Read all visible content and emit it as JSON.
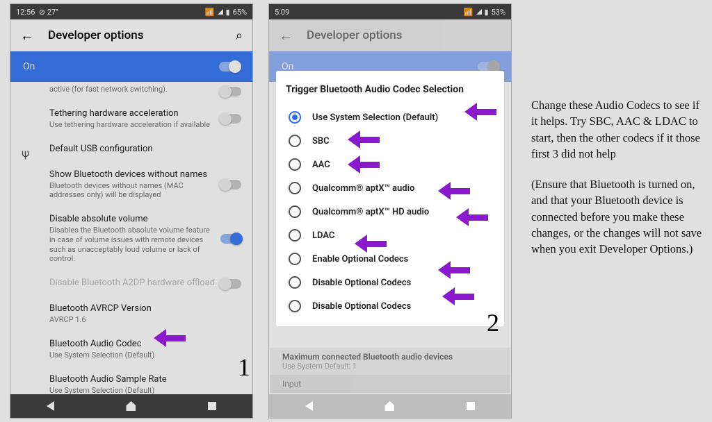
{
  "phone1": {
    "status": {
      "time": "12:56",
      "temp": "27°",
      "battery": "65%"
    },
    "appbar": {
      "title": "Developer options"
    },
    "onbar": "On",
    "rows": {
      "r0_sub": "active (for fast network switching).",
      "r1_title": "Tethering hardware acceleration",
      "r1_sub": "Use tethering hardware acceleration if available",
      "r2_title": "Default USB configuration",
      "r3_title": "Show Bluetooth devices without names",
      "r3_sub": "Bluetooth devices without names (MAC addresses only) will be displayed",
      "r4_title": "Disable absolute volume",
      "r4_sub": "Disables the Bluetooth absolute volume feature in case of volume issues with remote devices such as unacceptably loud volume or lack of control.",
      "r5_title": "Disable Bluetooth A2DP hardware offload",
      "r6_title": "Bluetooth AVRCP Version",
      "r6_sub": "AVRCP 1.6",
      "r7_title": "Bluetooth Audio Codec",
      "r7_sub": "Use System Selection (Default)",
      "r8_title": "Bluetooth Audio Sample Rate",
      "r8_sub": "Use System Selection (Default)"
    },
    "number": "1"
  },
  "phone2": {
    "status": {
      "time": "5:09",
      "battery": "53%"
    },
    "appbar": {
      "title": "Developer options"
    },
    "onbar": "On",
    "dialog": {
      "title": "Trigger Bluetooth Audio Codec Selection",
      "options": [
        "Use System Selection (Default)",
        "SBC",
        "AAC",
        "Qualcomm® aptX™ audio",
        "Qualcomm® aptX™ HD audio",
        "LDAC",
        "Enable Optional Codecs",
        "Disable Optional Codecs",
        "Disable Optional Codecs"
      ]
    },
    "dim1_t": "Maximum connected Bluetooth audio devices",
    "dim1_s": "Use System Default: 1",
    "dim2": "Input",
    "number": "2"
  },
  "instructions": {
    "p1": "Change these Audio Codecs to see if it helps. Try SBC, AAC & LDAC to start, then the other codecs if it those first 3 did not help",
    "p2": "(Ensure that Bluetooth is turned on, and that your Bluetooth device is connected before you make these changes, or the changes will not save when you exit Developer Options.)"
  }
}
